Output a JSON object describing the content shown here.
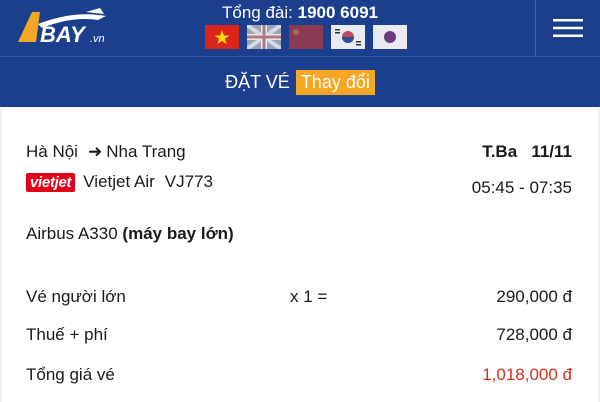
{
  "header": {
    "logo_text": "BAY",
    "logo_suffix": ".vn",
    "hotline_label": "Tổng đài:",
    "hotline_number": "1900 6091",
    "flags": [
      "vietnam-flag",
      "uk-flag",
      "china-flag",
      "korea-flag",
      "japan-flag"
    ],
    "menu_icon": "hamburger-menu-icon"
  },
  "subbar": {
    "title": "ĐẶT VÉ",
    "change_label": "Thay đổi"
  },
  "flight": {
    "from": "Hà Nội",
    "to": "Nha Trang",
    "day": "T.Ba",
    "date": "11/11",
    "airline_logo": "vietjet",
    "airline": "Vietjet Air",
    "code": "VJ773",
    "time": "05:45 - 07:35",
    "aircraft": "Airbus A330",
    "aircraft_note": "(máy bay lớn)"
  },
  "pricing": {
    "adult_label": "Vé người lớn",
    "adult_qty": "x 1 =",
    "adult_price": "290,000 đ",
    "tax_label": "Thuế + phí",
    "tax_price": "728,000 đ",
    "total_label": "Tổng giá vé",
    "total_price": "1,018,000 đ"
  },
  "colors": {
    "header_bg": "#1b3f8d",
    "accent": "#f5a623",
    "total": "#d0341c"
  }
}
